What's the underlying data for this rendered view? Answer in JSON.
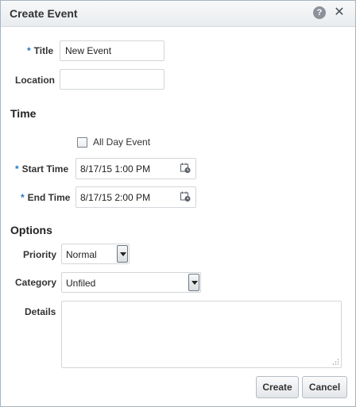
{
  "dialog": {
    "title": "Create Event",
    "help_icon": "help-icon",
    "close_icon": "close-icon"
  },
  "required_marker": "*",
  "fields": {
    "title": {
      "label": "Title",
      "value": "New Event",
      "required": true
    },
    "location": {
      "label": "Location",
      "value": ""
    }
  },
  "time": {
    "heading": "Time",
    "all_day": {
      "label": "All Day Event",
      "checked": false
    },
    "start": {
      "label": "Start Time",
      "value": "8/17/15 1:00 PM",
      "required": true,
      "icon": "calendar-clock-icon"
    },
    "end": {
      "label": "End Time",
      "value": "8/17/15 2:00 PM",
      "required": true,
      "icon": "calendar-clock-icon"
    }
  },
  "options": {
    "heading": "Options",
    "priority": {
      "label": "Priority",
      "selected": "Normal"
    },
    "category": {
      "label": "Category",
      "selected": "Unfiled"
    },
    "details": {
      "label": "Details",
      "value": ""
    }
  },
  "buttons": {
    "create": "Create",
    "cancel": "Cancel"
  },
  "colors": {
    "required_marker": "#2a78c5",
    "background_strip": "#c57a1e"
  }
}
